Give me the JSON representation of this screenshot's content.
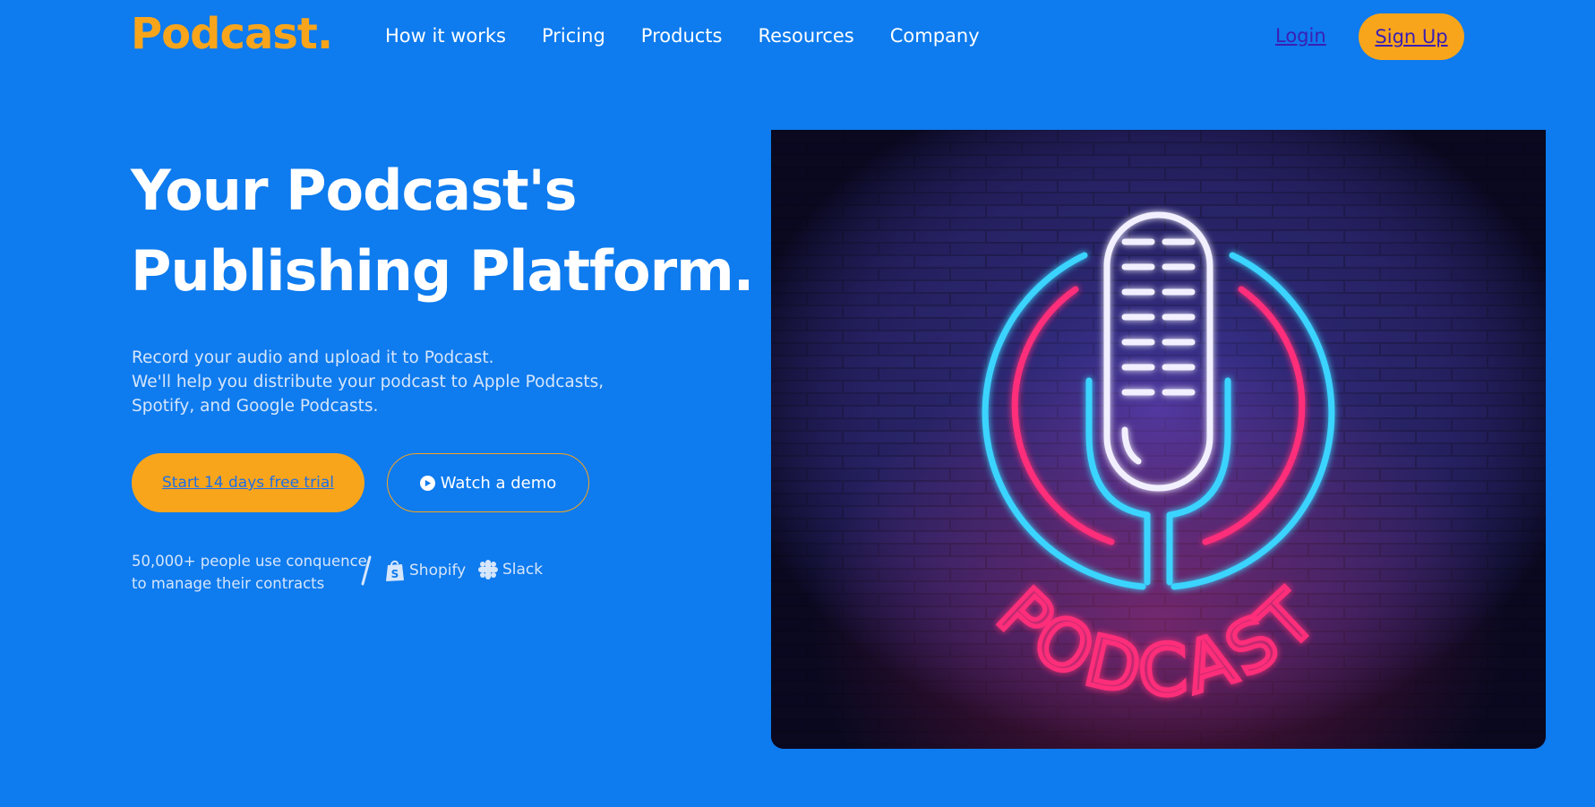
{
  "brand": {
    "logo_text": "Podcast."
  },
  "nav": {
    "items": [
      {
        "label": "How it works"
      },
      {
        "label": "Pricing"
      },
      {
        "label": "Products"
      },
      {
        "label": "Resources"
      },
      {
        "label": "Company"
      }
    ],
    "login_label": "Login",
    "signup_label": "Sign Up"
  },
  "hero": {
    "title_line1": "Your Podcast's",
    "title_line2": "Publishing Platform.",
    "description_lines": [
      "Record your audio and upload it to Podcast.",
      "We'll help you distribute your podcast to Apple Podcasts,",
      "Spotify, and Google Podcasts."
    ],
    "cta_primary": "Start 14 days free trial",
    "cta_secondary": "Watch a demo",
    "cta_secondary_icon": "play-circle-icon",
    "social_proof_lines": [
      "50,000+ people use conquence",
      "to manage their contracts"
    ],
    "brands": [
      {
        "name": "Shopify",
        "icon": "shopify-bag-icon"
      },
      {
        "name": "Slack",
        "icon": "slack-icon"
      }
    ],
    "image_text": "PODCAST"
  },
  "colors": {
    "background": "#0e7bee",
    "accent": "#f9a51b",
    "link": "#3a1fb5",
    "neon_blue": "#3ad4ff",
    "neon_pink": "#ff2f7a"
  }
}
